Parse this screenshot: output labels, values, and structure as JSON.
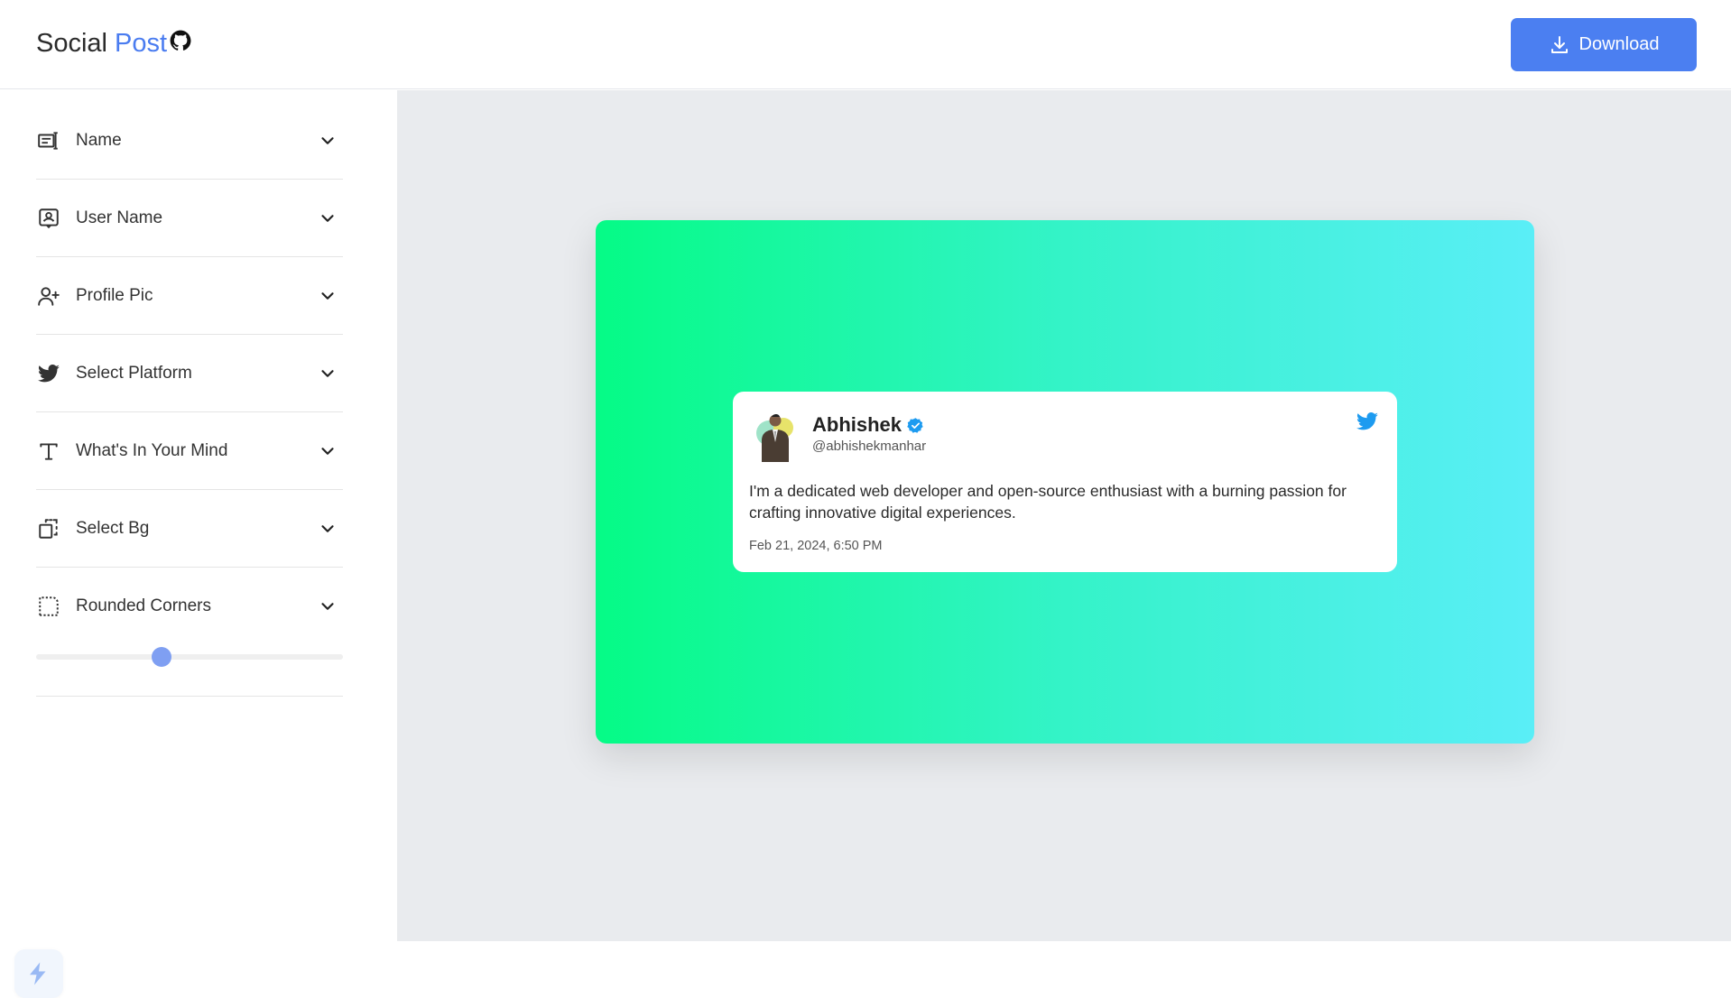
{
  "app": {
    "title_part1": "Social",
    "title_part2": "Post"
  },
  "header": {
    "download_label": "Download"
  },
  "sidebar": {
    "items": [
      {
        "label": "Name",
        "icon": "name-card-icon"
      },
      {
        "label": "User Name",
        "icon": "user-badge-icon"
      },
      {
        "label": "Profile Pic",
        "icon": "add-user-icon"
      },
      {
        "label": "Select Platform",
        "icon": "twitter-bird-icon"
      },
      {
        "label": "What's In Your Mind",
        "icon": "text-t-icon"
      },
      {
        "label": "Select Bg",
        "icon": "background-select-icon"
      },
      {
        "label": "Rounded Corners",
        "icon": "rounded-corner-icon"
      }
    ],
    "rounded_corners_value": 0.41
  },
  "preview": {
    "background_gradient": [
      "#05fb86",
      "#34f3c8",
      "#5aeef7"
    ],
    "post": {
      "name": "Abhishek",
      "username": "@abhishekmanhar",
      "text": "I'm a dedicated web developer and open-source enthusiast with a burning passion for crafting innovative digital experiences.",
      "date": "Feb 21, 2024, 6:50 PM",
      "verified": true,
      "platform": "twitter"
    }
  },
  "colors": {
    "accent": "#4b7ff1",
    "twitter": "#1d9bf0",
    "slider": "#7f9ff2"
  }
}
